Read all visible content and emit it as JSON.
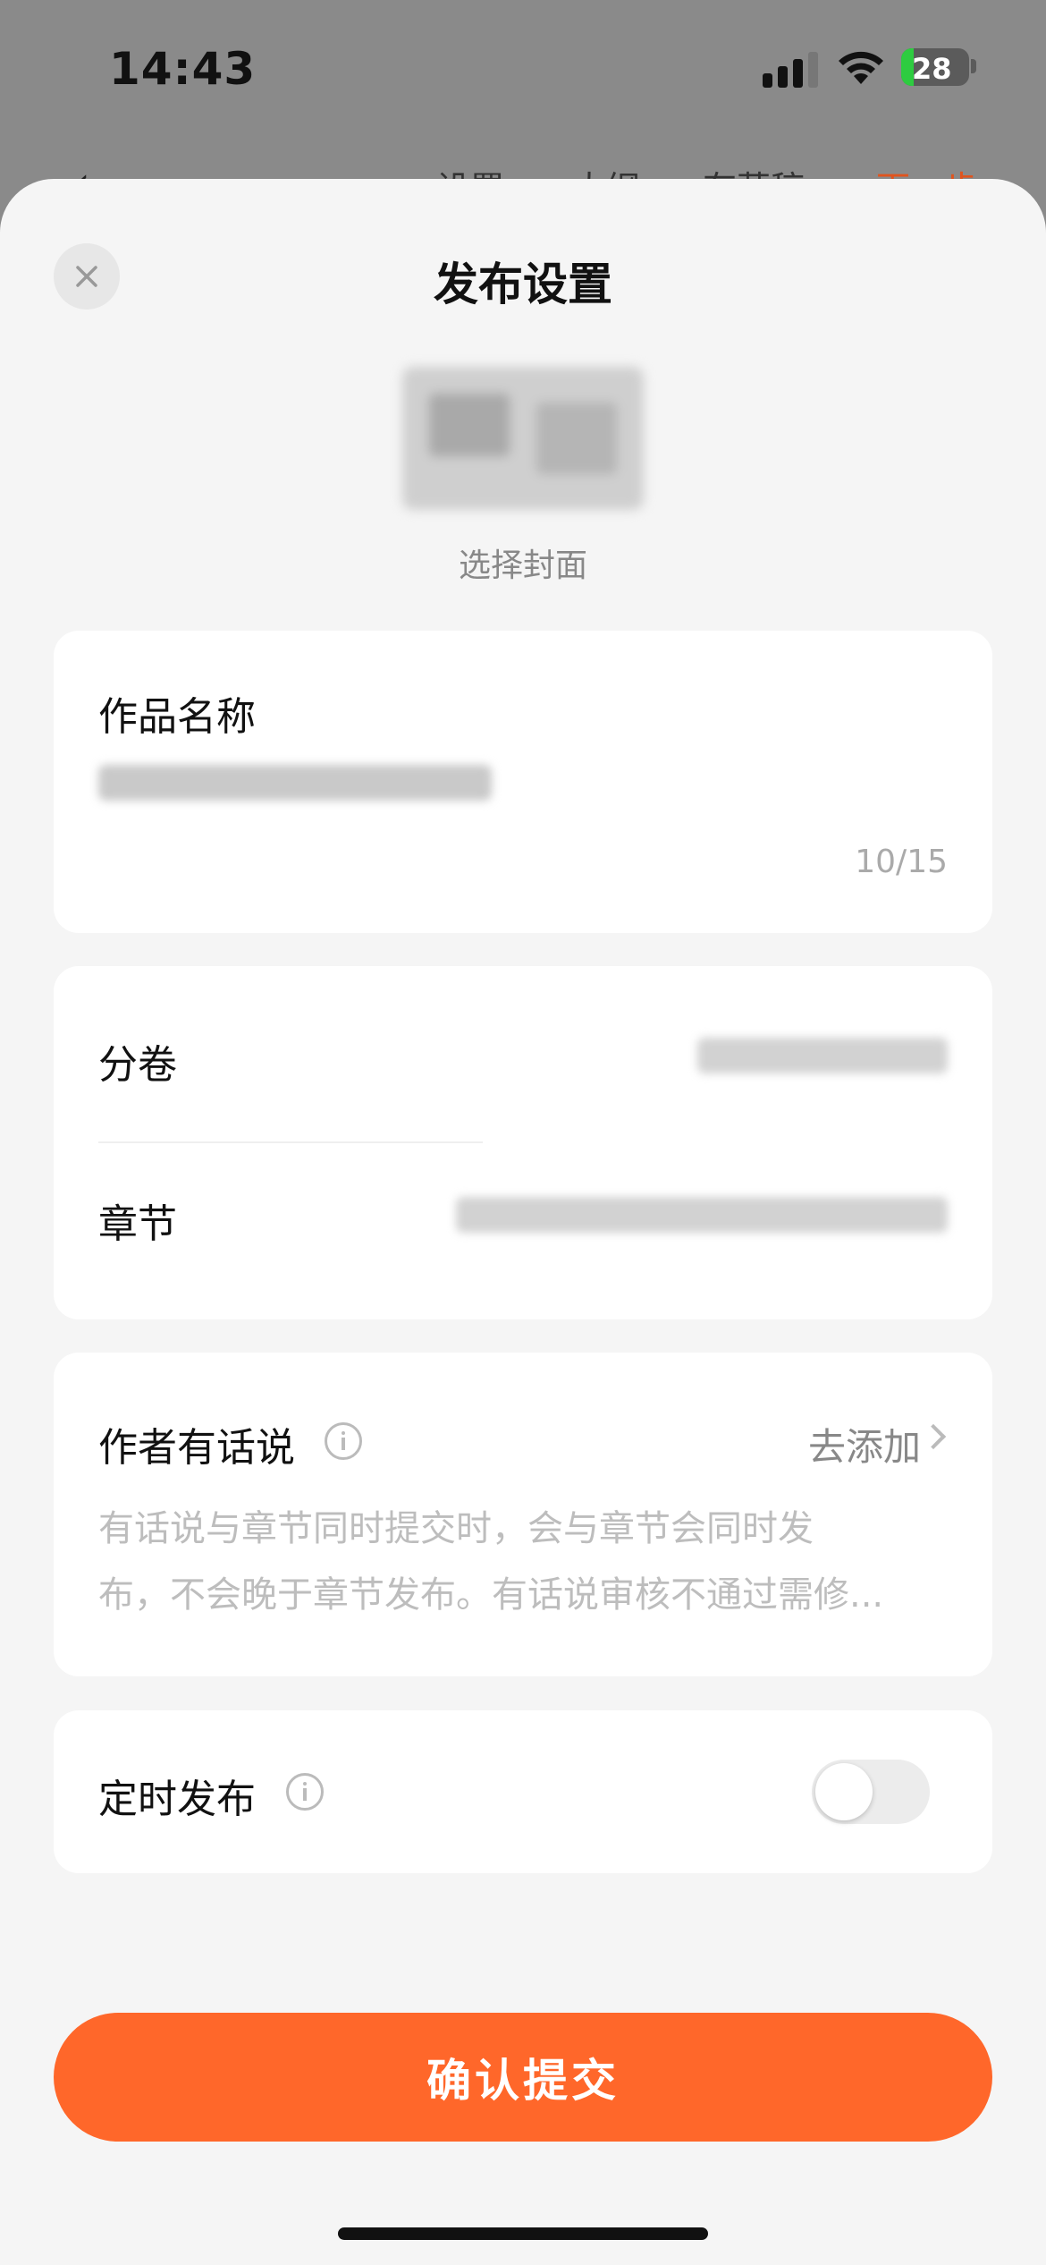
{
  "status_bar": {
    "time": "14:43",
    "battery": "28"
  },
  "background_nav": {
    "items": [
      "设置",
      "大纲",
      "存草稿",
      "下一步"
    ]
  },
  "sheet": {
    "title": "发布设置",
    "cover_label": "选择封面",
    "work_name": {
      "label": "作品名称",
      "counter": "10/15"
    },
    "volume": {
      "label": "分卷"
    },
    "chapter": {
      "label": "章节"
    },
    "author_note": {
      "label": "作者有话说",
      "action": "去添加",
      "desc_line1": "有话说与章节同时提交时，会与章节会同时发",
      "desc_line2": "布，不会晚于章节发布。有话说审核不通过需修..."
    },
    "schedule": {
      "label": "定时发布",
      "enabled": false
    },
    "submit_label": "确认提交"
  },
  "colors": {
    "accent": "#ff672a",
    "sheet_bg": "#f5f5f5",
    "card_bg": "#ffffff"
  }
}
